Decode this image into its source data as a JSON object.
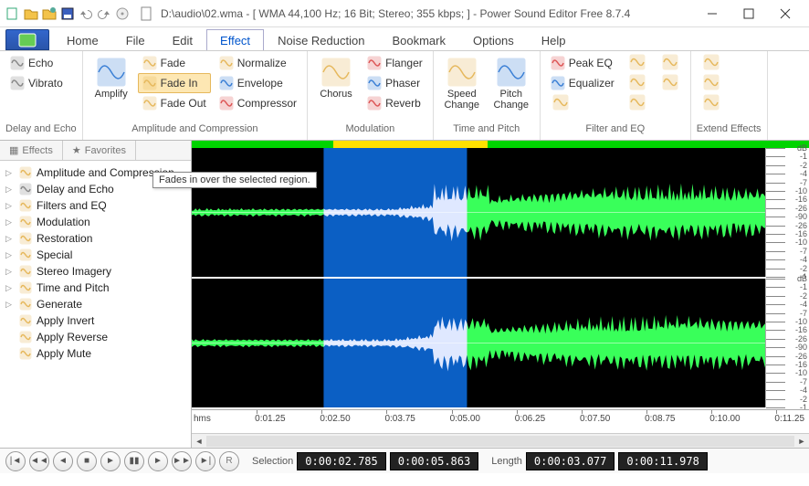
{
  "window": {
    "title": "D:\\audio\\02.wma - [ WMA 44,100 Hz; 16 Bit; Stereo; 355 kbps; ] - Power Sound Editor Free 8.7.4"
  },
  "menu": {
    "tabs": [
      "Home",
      "File",
      "Edit",
      "Effect",
      "Noise Reduction",
      "Bookmark",
      "Options",
      "Help"
    ],
    "active": 3
  },
  "ribbon": {
    "groups": [
      {
        "label": "Delay and Echo",
        "buttons": [
          {
            "t": "sm",
            "label": "Echo",
            "icon": "echo"
          },
          {
            "t": "sm",
            "label": "Vibrato",
            "icon": "vibrato"
          }
        ]
      },
      {
        "label": "Amplitude and Compression",
        "buttons": [
          {
            "t": "lg",
            "label": "Amplify",
            "icon": "amplify"
          },
          {
            "t": "sm",
            "label": "Fade",
            "icon": "fade"
          },
          {
            "t": "sm",
            "label": "Fade In",
            "icon": "fadein",
            "hover": true
          },
          {
            "t": "sm",
            "label": "Fade Out",
            "icon": "fadeout"
          },
          {
            "t": "sm",
            "label": "Normalize",
            "icon": "normalize"
          },
          {
            "t": "sm",
            "label": "Envelope",
            "icon": "envelope"
          },
          {
            "t": "sm",
            "label": "Compressor",
            "icon": "compressor"
          }
        ]
      },
      {
        "label": "Modulation",
        "buttons": [
          {
            "t": "lg",
            "label": "Chorus",
            "icon": "chorus"
          },
          {
            "t": "sm",
            "label": "Flanger",
            "icon": "flanger"
          },
          {
            "t": "sm",
            "label": "Phaser",
            "icon": "phaser"
          },
          {
            "t": "sm",
            "label": "Reverb",
            "icon": "reverb"
          }
        ]
      },
      {
        "label": "Time and Pitch",
        "buttons": [
          {
            "t": "lg",
            "label": "Speed Change",
            "icon": "speed"
          },
          {
            "t": "lg",
            "label": "Pitch Change",
            "icon": "pitch"
          }
        ]
      },
      {
        "label": "Filter and EQ",
        "buttons": [
          {
            "t": "sm",
            "label": "Peak EQ",
            "icon": "peakeq"
          },
          {
            "t": "sm",
            "label": "Equalizer",
            "icon": "equalizer"
          },
          {
            "t": "ic",
            "icon": "filter1"
          },
          {
            "t": "ic",
            "icon": "filter2"
          },
          {
            "t": "ic",
            "icon": "filter3"
          },
          {
            "t": "ic",
            "icon": "filter4"
          },
          {
            "t": "ic",
            "icon": "filter5"
          },
          {
            "t": "ic",
            "icon": "filter6"
          }
        ]
      },
      {
        "label": "Extend Effects",
        "buttons": [
          {
            "t": "ic",
            "icon": "ext1"
          },
          {
            "t": "ic",
            "icon": "ext2"
          },
          {
            "t": "ic",
            "icon": "ext3"
          }
        ]
      }
    ]
  },
  "tooltip": "Fades in over the selected region.",
  "sidebar": {
    "tabs": [
      "Effects",
      "Favorites"
    ],
    "items": [
      {
        "label": "Amplitude and Compression",
        "icon": "amp",
        "expand": true
      },
      {
        "label": "Delay and Echo",
        "icon": "echo",
        "expand": true
      },
      {
        "label": "Filters and EQ",
        "icon": "eq",
        "expand": true
      },
      {
        "label": "Modulation",
        "icon": "mod",
        "expand": true
      },
      {
        "label": "Restoration",
        "icon": "rest",
        "expand": true
      },
      {
        "label": "Special",
        "icon": "spec",
        "expand": true
      },
      {
        "label": "Stereo Imagery",
        "icon": "stereo",
        "expand": true
      },
      {
        "label": "Time and Pitch",
        "icon": "time",
        "expand": true
      },
      {
        "label": "Generate",
        "icon": "gen",
        "expand": true
      },
      {
        "label": "Apply Invert",
        "icon": "invert",
        "expand": false
      },
      {
        "label": "Apply Reverse",
        "icon": "reverse",
        "expand": false
      },
      {
        "label": "Apply Mute",
        "icon": "mute",
        "expand": false
      }
    ]
  },
  "waveform": {
    "selection_start_frac": 0.23,
    "selection_end_frac": 0.48,
    "db_labels": [
      "dB",
      "-1",
      "-2",
      "-4",
      "-7",
      "-10",
      "-16",
      "-26",
      "-90",
      "-26",
      "-16",
      "-10",
      "-7",
      "-4",
      "-2",
      "-1"
    ]
  },
  "timeruler": {
    "unit": "hms",
    "ticks": [
      "0:01.25",
      "0:02.50",
      "0:03.75",
      "0:05.00",
      "0:06.25",
      "0:07.50",
      "0:08.75",
      "0:10.00",
      "0:11.25"
    ]
  },
  "status": {
    "selection_label": "Selection",
    "selection_start": "0:00:02.785",
    "selection_end": "0:00:05.863",
    "length_label": "Length",
    "length_val": "0:00:03.077",
    "total": "0:00:11.978"
  },
  "colors": {
    "wave": "#39ff5a",
    "wave_bg": "#000000",
    "selection": "#0b5fc4",
    "marker": "#00d400"
  }
}
